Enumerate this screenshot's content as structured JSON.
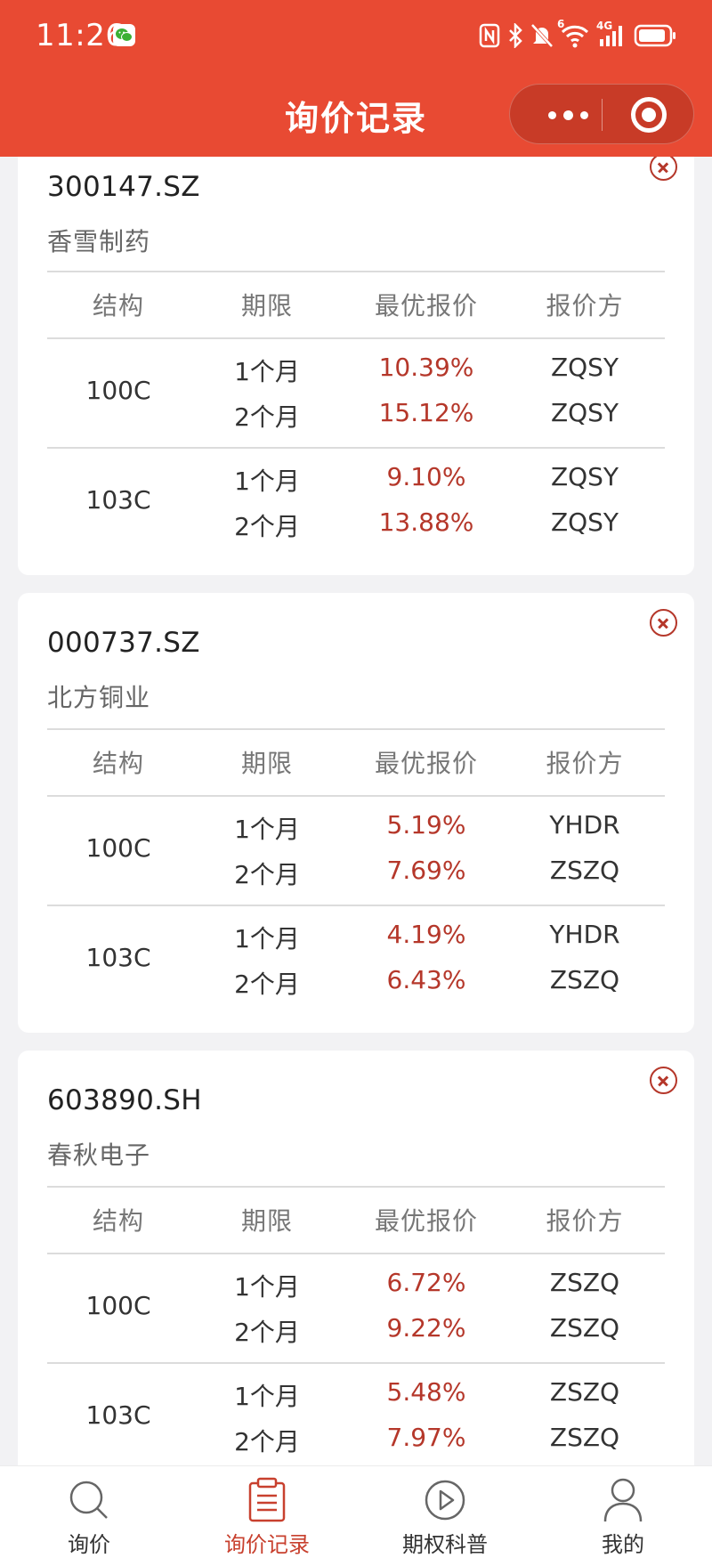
{
  "status_bar": {
    "time": "11:26",
    "signal_label": "4G",
    "wifi_badge": "6"
  },
  "header": {
    "title": "询价记录"
  },
  "table_headers": [
    "结构",
    "期限",
    "最优报价",
    "报价方"
  ],
  "records": [
    {
      "code": "300147.SZ",
      "name": "香雪制药",
      "groups": [
        {
          "structure": "100C",
          "rows": [
            {
              "term": "1个月",
              "rate": "10.39%",
              "quoter": "ZQSY"
            },
            {
              "term": "2个月",
              "rate": "15.12%",
              "quoter": "ZQSY"
            }
          ]
        },
        {
          "structure": "103C",
          "rows": [
            {
              "term": "1个月",
              "rate": "9.10%",
              "quoter": "ZQSY"
            },
            {
              "term": "2个月",
              "rate": "13.88%",
              "quoter": "ZQSY"
            }
          ]
        }
      ]
    },
    {
      "code": "000737.SZ",
      "name": "北方铜业",
      "groups": [
        {
          "structure": "100C",
          "rows": [
            {
              "term": "1个月",
              "rate": "5.19%",
              "quoter": "YHDR"
            },
            {
              "term": "2个月",
              "rate": "7.69%",
              "quoter": "ZSZQ"
            }
          ]
        },
        {
          "structure": "103C",
          "rows": [
            {
              "term": "1个月",
              "rate": "4.19%",
              "quoter": "YHDR"
            },
            {
              "term": "2个月",
              "rate": "6.43%",
              "quoter": "ZSZQ"
            }
          ]
        }
      ]
    },
    {
      "code": "603890.SH",
      "name": "春秋电子",
      "groups": [
        {
          "structure": "100C",
          "rows": [
            {
              "term": "1个月",
              "rate": "6.72%",
              "quoter": "ZSZQ"
            },
            {
              "term": "2个月",
              "rate": "9.22%",
              "quoter": "ZSZQ"
            }
          ]
        },
        {
          "structure": "103C",
          "rows": [
            {
              "term": "1个月",
              "rate": "5.48%",
              "quoter": "ZSZQ"
            },
            {
              "term": "2个月",
              "rate": "7.97%",
              "quoter": "ZSZQ"
            }
          ]
        }
      ]
    }
  ],
  "tabbar": [
    {
      "label": "询价",
      "icon": "search-icon",
      "active": false
    },
    {
      "label": "询价记录",
      "icon": "clipboard-icon",
      "active": true
    },
    {
      "label": "期权科普",
      "icon": "play-circle-icon",
      "active": false
    },
    {
      "label": "我的",
      "icon": "user-icon",
      "active": false
    }
  ],
  "colors": {
    "header_bg": "#e84a33",
    "accent": "#b5372a",
    "active_tab": "#c8402e"
  }
}
